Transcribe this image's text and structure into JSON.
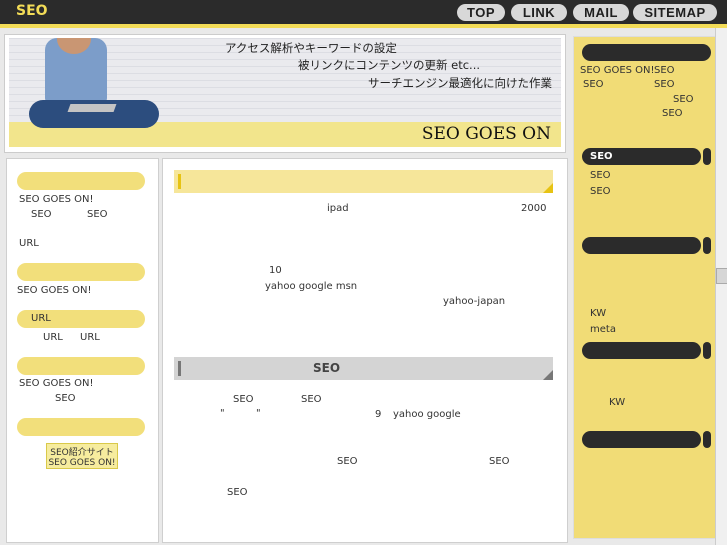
{
  "header": {
    "logo": "SEO",
    "nav": [
      "TOP",
      "LINK",
      "MAIL",
      "SITEMAP"
    ]
  },
  "banner": {
    "line1": "アクセス解析やキーワードの設定",
    "line2": "被リンクにコンテンツの更新 etc...",
    "line3": "サーチエンジン最適化に向けた作業",
    "title": "SEO GOES ON"
  },
  "left": {
    "t1": "SEO GOES ON!",
    "t2a": "SEO",
    "t2b": "SEO",
    "t3": "URL",
    "t4": "SEO GOES ON!",
    "pill3": "URL",
    "t5a": "URL",
    "t5b": "URL",
    "t6": "SEO GOES ON!",
    "t7": "SEO",
    "badge1": "SEO紹介サイト",
    "badge2": "SEO GOES ON!"
  },
  "content": {
    "s1": {
      "a": "ipad",
      "b": "2000",
      "c": "10",
      "d": "yahoo google msn",
      "e": "yahoo-japan"
    },
    "s2": {
      "heading": "SEO",
      "a": "SEO",
      "b": "SEO",
      "q1": "\"",
      "q2": "\"",
      "num": "9",
      "yg": "yahoo google",
      "c": "SEO",
      "d": "SEO",
      "e": "SEO"
    }
  },
  "right": {
    "r1a": "SEO GOES ON!",
    "r1b": "SEO",
    "r2a": "SEO",
    "r2b": "SEO",
    "r3": "SEO",
    "r4": "SEO",
    "active": "SEO",
    "r5": "SEO",
    "r6": "SEO",
    "kw1": "KW",
    "meta": "meta",
    "kw2": "KW"
  },
  "colors": {
    "accent": "#f3dc57",
    "dark": "#2b2b2b",
    "panel": "#f1dc76"
  }
}
